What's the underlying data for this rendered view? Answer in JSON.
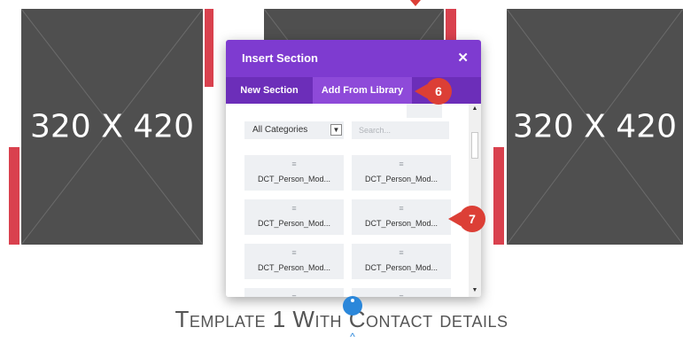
{
  "placeholders": [
    {
      "text": "320 X 420"
    },
    {
      "text": "320 X 420"
    }
  ],
  "modal": {
    "title": "Insert Section",
    "close_icon": "close-icon",
    "tabs": [
      {
        "label": "New Section"
      },
      {
        "label": "Add From Library"
      }
    ],
    "filter": {
      "category_selected": "All Categories",
      "search_placeholder": "Search..."
    },
    "items": [
      {
        "label": "DCT_Person_Mod..."
      },
      {
        "label": "DCT_Person_Mod..."
      },
      {
        "label": "DCT_Person_Mod..."
      },
      {
        "label": "DCT_Person_Mod..."
      },
      {
        "label": "DCT_Person_Mod..."
      },
      {
        "label": "DCT_Person_Mod..."
      }
    ],
    "item_icon": "≡"
  },
  "badges": {
    "step6": "6",
    "step7": "7"
  },
  "heading": "Template 1 With Contact details",
  "colors": {
    "accent_purple": "#7e3bd0",
    "tab_purple": "#6c2eb9",
    "badge_red": "#dc3f36",
    "placeholder_gray": "#4f4f4f",
    "bar_red": "#d9414e",
    "blue": "#2b87da"
  }
}
